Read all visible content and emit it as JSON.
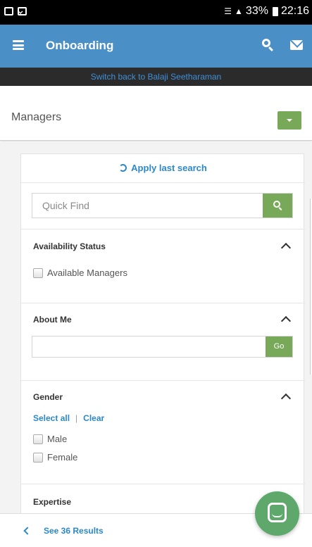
{
  "status_bar": {
    "battery": "33%",
    "time": "22:16",
    "icons": [
      "gallery-icon",
      "mail-icon",
      "wifi-icon",
      "signal-icon",
      "battery-icon"
    ]
  },
  "app_bar": {
    "title": "Onboarding",
    "color": "#4a8fc6",
    "icons": [
      "menu-icon",
      "search-icon",
      "mail-icon"
    ]
  },
  "switch_bar": {
    "text": "Switch back to Balaji Seetharaman"
  },
  "page": {
    "title": "Managers"
  },
  "filters": {
    "apply_last_search": "Apply last search",
    "quick_find": {
      "placeholder": "Quick Find",
      "value": ""
    },
    "sections": {
      "availability": {
        "title": "Availability Status",
        "options": [
          "Available Managers"
        ]
      },
      "about_me": {
        "title": "About Me",
        "value": "",
        "go_label": "Go"
      },
      "gender": {
        "title": "Gender",
        "select_all": "Select all",
        "separator": "|",
        "clear": "Clear",
        "options": [
          "Male",
          "Female"
        ]
      },
      "expertise": {
        "title": "Expertise"
      }
    }
  },
  "bottom_bar": {
    "results_label": "See 36 Results"
  },
  "colors": {
    "accent_green": "#77a959",
    "link_blue": "#2c88c8",
    "fab_green": "#5ea86c"
  }
}
